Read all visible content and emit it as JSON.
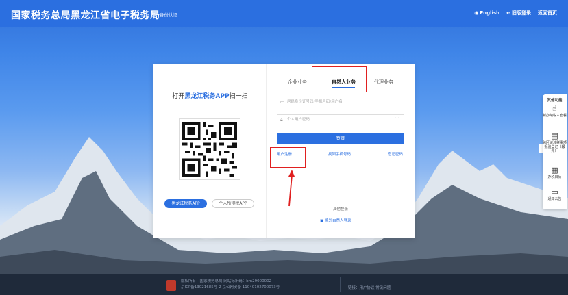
{
  "header": {
    "title": "国家税务总局黑龙江省电子税务局",
    "subtitle": "统一身份认证",
    "links": [
      {
        "icon": "globe-icon",
        "label": "English"
      },
      {
        "icon": "return-icon",
        "label": "旧版登录"
      },
      {
        "icon": "",
        "label": "返回首页"
      }
    ]
  },
  "qr_panel": {
    "title_prefix": "打开",
    "title_app": "黑龙江税务APP",
    "title_suffix": "扫一扫",
    "buttons": [
      "黑龙江税务APP",
      "个人所得税APP"
    ]
  },
  "login_panel": {
    "tabs": [
      "企业业务",
      "自然人业务",
      "代理业务"
    ],
    "active_tab": "自然人业务",
    "account_placeholder": "居民身份证号码/手机号码/用户名",
    "password_placeholder": "个人用户密码",
    "login_button": "登录",
    "links": [
      "用户注册",
      "找回手机号码",
      "忘记密码"
    ],
    "other_login_title": "其他登录",
    "natural_person_login": "境外自然人登录"
  },
  "sidebar": {
    "title": "其他功能",
    "items": [
      {
        "icon": "hand-pointer-icon",
        "label": "新办纳税人套餐"
      },
      {
        "icon": "document-icon",
        "label": "跨区域涉税事项报验登记（報外）"
      },
      {
        "icon": "calendar-icon",
        "label": "办税日历"
      },
      {
        "icon": "notice-icon",
        "label": "通知公告"
      }
    ]
  },
  "footer": {
    "lines": [
      "版权所有：国家税务总局  网站标识码：bm29000002",
      "京ICP备13021685号-2  京公网安备 11040102700073号"
    ],
    "right": "链接：用户协议  常见问题"
  }
}
